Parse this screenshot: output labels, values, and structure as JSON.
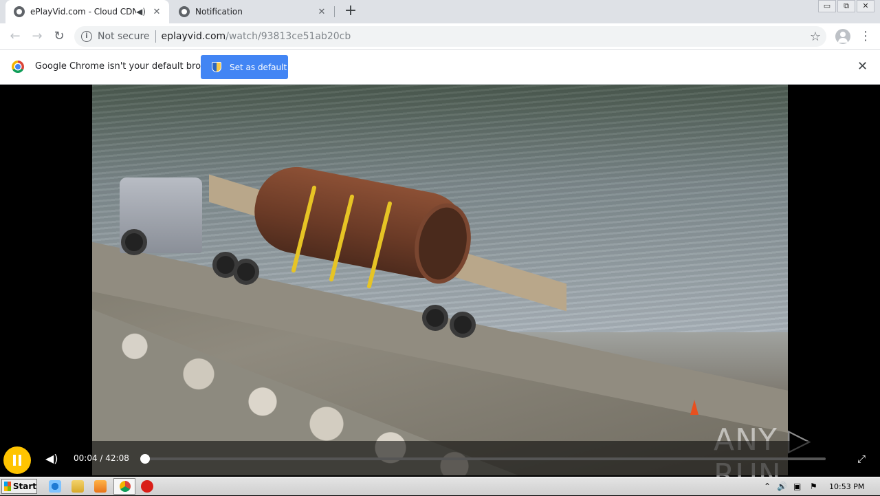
{
  "tabs": [
    {
      "title": "ePlayVid.com - Cloud CDN",
      "audio_icon": "speaker-icon",
      "close": "✕"
    },
    {
      "title": "Notification",
      "close": "✕"
    }
  ],
  "new_tab_label": "+",
  "window_controls": {
    "minimize": "▭",
    "restore": "⧉",
    "close": "✕"
  },
  "toolbar": {
    "back": "←",
    "forward": "→",
    "reload": "↻",
    "security_label": "Not secure",
    "url_host": "eplayvid.com",
    "url_path": "/watch/93813ce51ab20cb",
    "bookmark": "☆",
    "menu": "⋮"
  },
  "infobar": {
    "message": "Google Chrome isn't your default browser",
    "button_label": "Set as default",
    "close": "✕"
  },
  "player": {
    "current_time": "00:04",
    "separator": " / ",
    "duration": "42:08",
    "time_text": "00:04 / 42:08",
    "progress_fraction": 0.0016,
    "accent_color": "#ffc400",
    "watermark": "ANY ▷ RUN",
    "volume_icon": "🔊",
    "fullscreen_icon": "⤢"
  },
  "taskbar": {
    "start_label": "Start",
    "clock": "10:53 PM",
    "tray_icons": [
      "⌃",
      "🔊",
      "▣",
      "⚑"
    ]
  }
}
